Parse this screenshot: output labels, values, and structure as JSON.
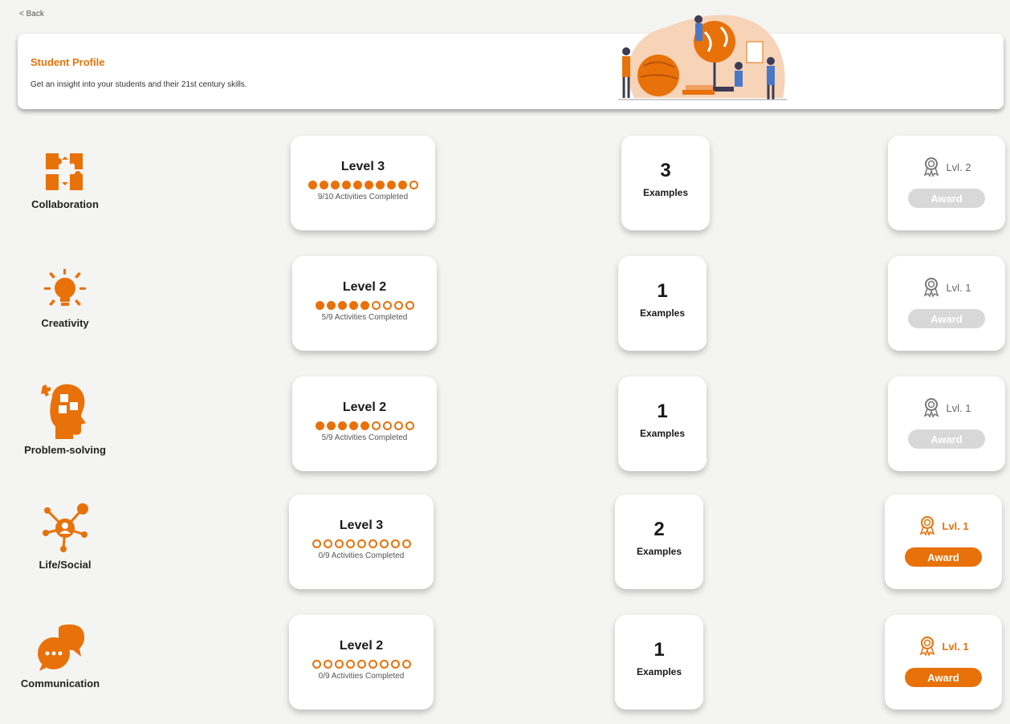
{
  "nav": {
    "back_label": "< Back"
  },
  "header": {
    "title": "Student Profile",
    "subtitle": "Get an insight into your students and their 21st century skills."
  },
  "colors": {
    "accent": "#e8710a",
    "inactive": "#d8d8d8"
  },
  "skills": [
    {
      "name": "Collaboration",
      "icon": "puzzle-arrows-icon",
      "level": "Level 3",
      "filled": 9,
      "total": 10,
      "activities": "9/10 Activities Completed",
      "examples_count": "3",
      "examples_label": "Examples",
      "award_level": "Lvl. 2",
      "award_label": "Award",
      "award_active": false
    },
    {
      "name": "Creativity",
      "icon": "lightbulb-icon",
      "level": "Level 2",
      "filled": 5,
      "total": 9,
      "activities": "5/9 Activities Completed",
      "examples_count": "1",
      "examples_label": "Examples",
      "award_level": "Lvl. 1",
      "award_label": "Award",
      "award_active": false
    },
    {
      "name": "Problem-solving",
      "icon": "head-puzzle-icon",
      "level": "Level 2",
      "filled": 5,
      "total": 9,
      "activities": "5/9 Activities Completed",
      "examples_count": "1",
      "examples_label": "Examples",
      "award_level": "Lvl. 1",
      "award_label": "Award",
      "award_active": false
    },
    {
      "name": "Life/Social",
      "icon": "social-network-icon",
      "level": "Level 3",
      "filled": 0,
      "total": 9,
      "activities": "0/9 Activities Completed",
      "examples_count": "2",
      "examples_label": "Examples",
      "award_level": "Lvl. 1",
      "award_label": "Award",
      "award_active": true
    },
    {
      "name": "Communication",
      "icon": "chat-bubbles-icon",
      "level": "Level 2",
      "filled": 0,
      "total": 9,
      "activities": "0/9 Activities Completed",
      "examples_count": "1",
      "examples_label": "Examples",
      "award_level": "Lvl. 1",
      "award_label": "Award",
      "award_active": true
    }
  ]
}
